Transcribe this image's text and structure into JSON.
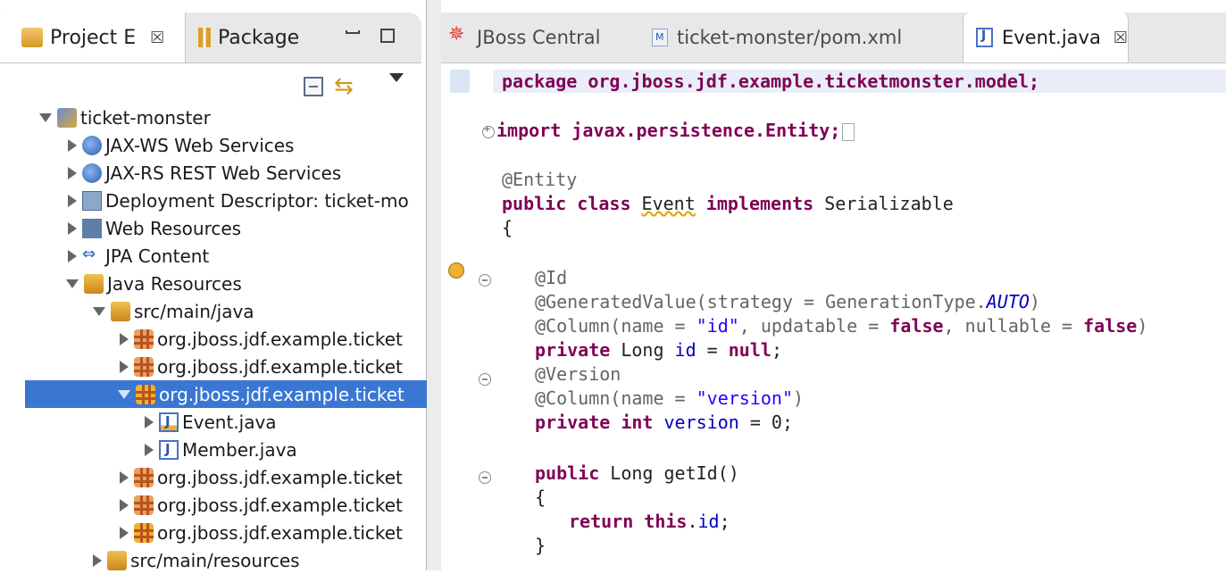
{
  "left_panel": {
    "tabs": [
      {
        "label": "Project E",
        "close": "☒"
      },
      {
        "label": "Package"
      }
    ],
    "tree": [
      {
        "label": "ticket-monster",
        "icon": "project-icon",
        "level": 0,
        "expanded": true
      },
      {
        "label": "JAX-WS Web Services",
        "icon": "web-services-icon",
        "level": 1,
        "expanded": false
      },
      {
        "label": "JAX-RS REST Web Services",
        "icon": "web-services-icon",
        "level": 1,
        "expanded": false
      },
      {
        "label": "Deployment Descriptor: ticket-mo",
        "icon": "deployment-descriptor-icon",
        "level": 1,
        "expanded": false
      },
      {
        "label": "Web Resources",
        "icon": "web-resources-icon",
        "level": 1,
        "expanded": false
      },
      {
        "label": "JPA Content",
        "icon": "jpa-icon",
        "level": 1,
        "expanded": false
      },
      {
        "label": "Java Resources",
        "icon": "java-resources-icon",
        "level": 1,
        "expanded": true
      },
      {
        "label": "src/main/java",
        "icon": "source-folder-icon",
        "level": 2,
        "expanded": true
      },
      {
        "label": "org.jboss.jdf.example.ticket",
        "icon": "package-icon",
        "level": 3,
        "expanded": false
      },
      {
        "label": "org.jboss.jdf.example.ticket",
        "icon": "package-icon",
        "level": 3,
        "expanded": false
      },
      {
        "label": "org.jboss.jdf.example.ticket",
        "icon": "package-icon",
        "level": 3,
        "expanded": true,
        "selected": true
      },
      {
        "label": "Event.java",
        "icon": "java-file-icon",
        "level": 4,
        "expanded": false
      },
      {
        "label": "Member.java",
        "icon": "java-file-icon",
        "level": 4,
        "expanded": false
      },
      {
        "label": "org.jboss.jdf.example.ticket",
        "icon": "package-icon",
        "level": 3,
        "expanded": false
      },
      {
        "label": "org.jboss.jdf.example.ticket",
        "icon": "package-icon",
        "level": 3,
        "expanded": false
      },
      {
        "label": "org.jboss.jdf.example.ticket",
        "icon": "package-icon",
        "level": 3,
        "expanded": false
      },
      {
        "label": "src/main/resources",
        "icon": "source-folder-icon",
        "level": 2,
        "expanded": false
      }
    ]
  },
  "editor": {
    "tabs": [
      {
        "label": "JBoss Central",
        "icon": "jboss-central-icon"
      },
      {
        "label": "ticket-monster/pom.xml",
        "icon": "pom-xml-icon"
      },
      {
        "label": "Event.java",
        "icon": "java-file-icon",
        "active": true,
        "close": "☒"
      }
    ],
    "code": {
      "l1": "package org.jboss.jdf.example.ticketmonster.model;",
      "l2": "import javax.persistence.Entity;",
      "l3": "@Entity",
      "l4a": "public class ",
      "l4b": "Event",
      "l4c": " implements ",
      "l4d": "Serializable",
      "l5": "{",
      "l6": "@Id",
      "l7a": "@GeneratedValue(strategy = GenerationType.",
      "l7b": "AUTO",
      "l7c": ")",
      "l8a": "@Column(name = ",
      "l8b": "\"id\"",
      "l8c": ", updatable = ",
      "l8d": "false",
      "l8e": ", nullable = ",
      "l8f": "false",
      "l8g": ")",
      "l9a": "private",
      "l9b": " Long ",
      "l9c": "id",
      "l9d": " = ",
      "l9e": "null",
      "l9f": ";",
      "l10": "@Version",
      "l11a": "@Column(name = ",
      "l11b": "\"version\"",
      "l11c": ")",
      "l12a": "private int",
      "l12b": " ",
      "l12c": "version",
      "l12d": " = 0;",
      "l13a": "public",
      "l13b": " Long getId()",
      "l14": "{",
      "l15a": "return this",
      "l15b": ".",
      "l15c": "id",
      "l15d": ";",
      "l16": "}"
    }
  }
}
